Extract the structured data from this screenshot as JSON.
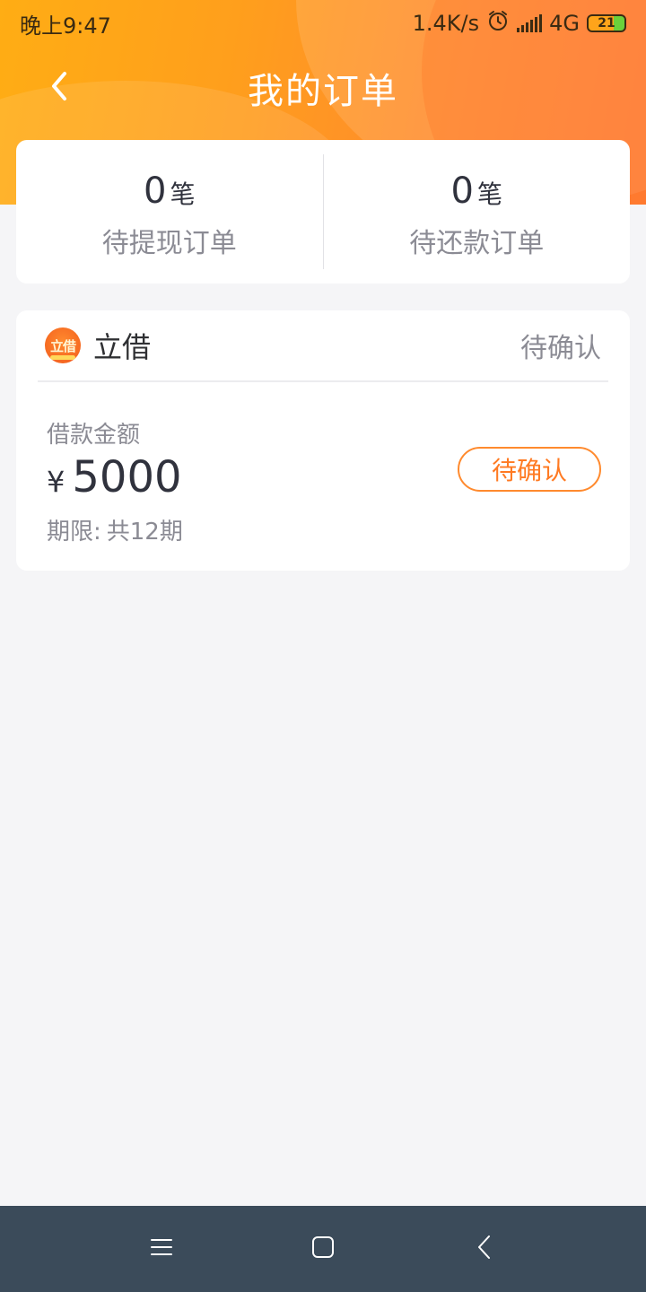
{
  "status_bar": {
    "time": "晚上9:47",
    "network_speed": "1.4K/s",
    "network_type": "4G",
    "battery_level": "21",
    "icons": [
      "alarm-icon",
      "signal-icon",
      "battery-icon"
    ]
  },
  "nav": {
    "title": "我的订单",
    "back_icon": "chevron-left-icon"
  },
  "summary": {
    "pending_withdraw": {
      "count": "0",
      "unit": "笔",
      "label": "待提现订单"
    },
    "pending_repay": {
      "count": "0",
      "unit": "笔",
      "label": "待还款订单"
    }
  },
  "order": {
    "vendor_name": "立借",
    "vendor_logo_text": "立借",
    "status": "待确认",
    "loan_label": "借款金额",
    "currency": "¥",
    "amount": "5000",
    "term_label": "期限:",
    "term_value": "共12期",
    "action_label": "待确认"
  },
  "system_nav": {
    "icons": [
      "menu-icon",
      "home-icon",
      "back-icon"
    ]
  },
  "colors": {
    "header_start": "#ffad14",
    "header_end": "#ff7a33",
    "accent": "#ff8a2e",
    "background": "#f5f5f7",
    "system_nav": "#3b4b5a"
  }
}
